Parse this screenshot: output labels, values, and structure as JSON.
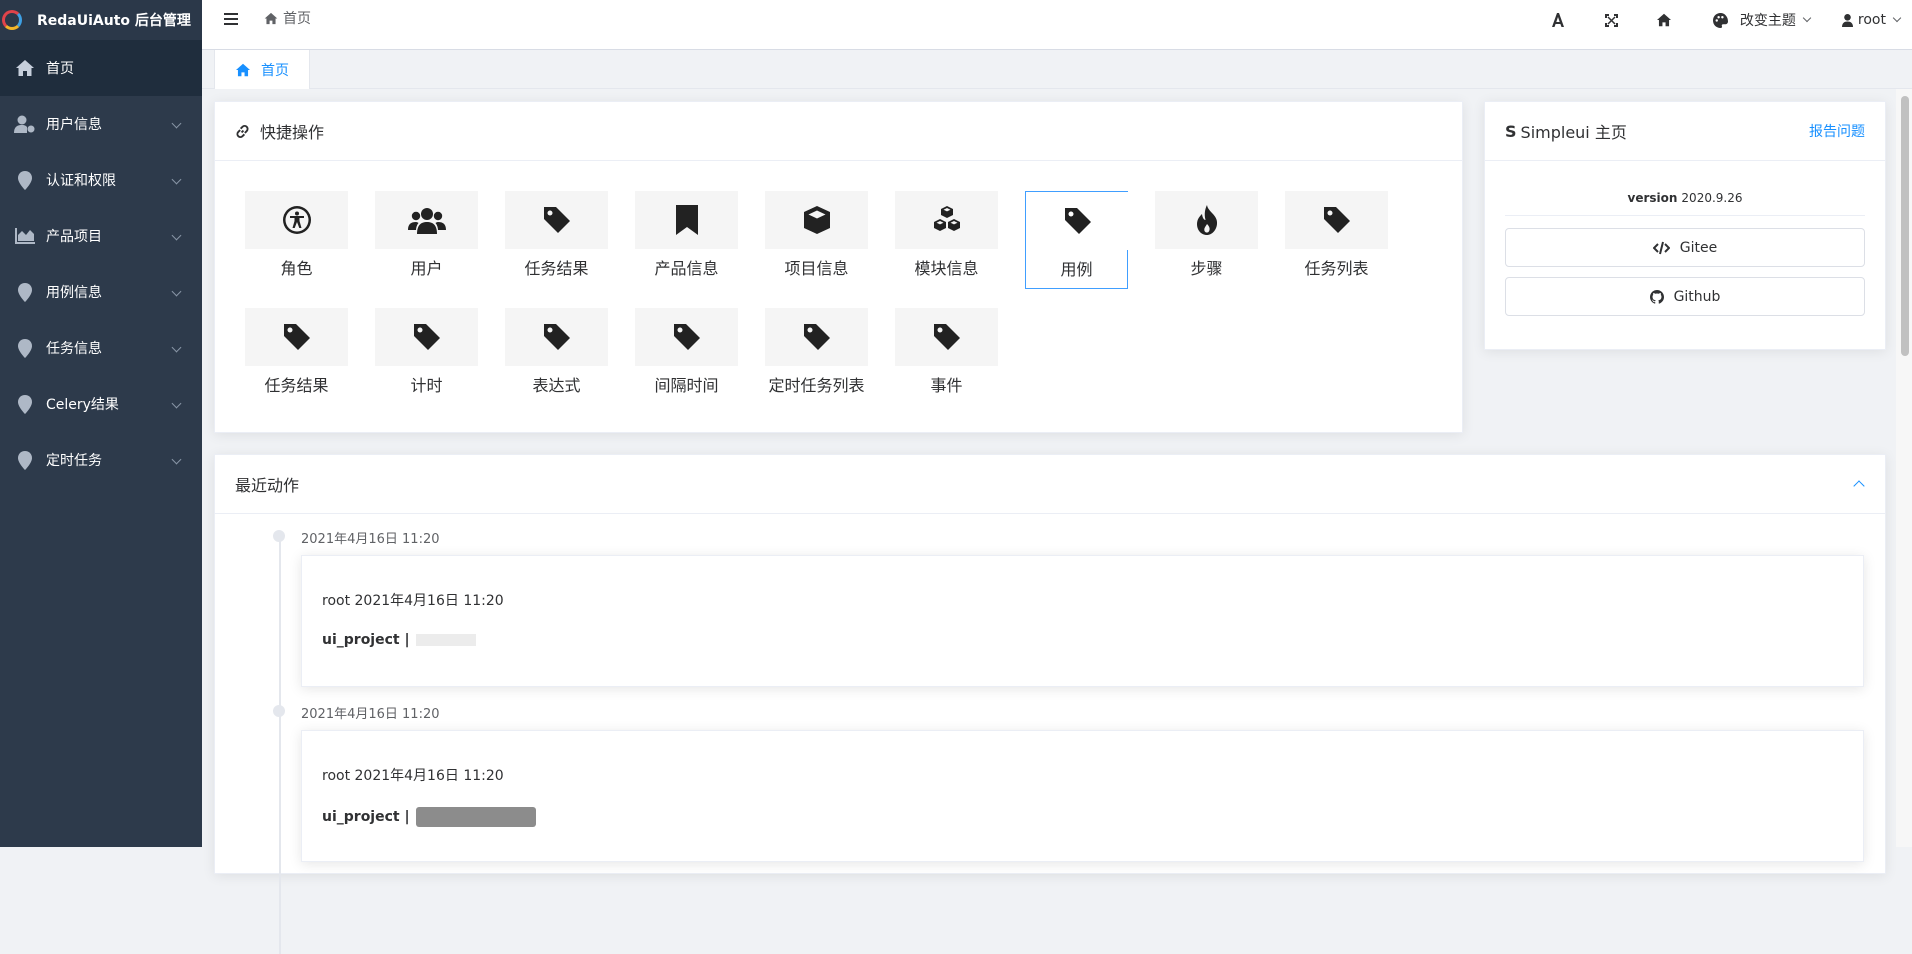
{
  "app": {
    "title": "RedaUiAuto 后台管理"
  },
  "sidebar": {
    "items": [
      {
        "label": "首页",
        "icon": "home-icon",
        "active": true
      },
      {
        "label": "用户信息",
        "icon": "user-cog-icon",
        "active": false
      },
      {
        "label": "认证和权限",
        "icon": "map-marker-icon",
        "active": false
      },
      {
        "label": "产品项目",
        "icon": "chart-area-icon",
        "active": false
      },
      {
        "label": "用例信息",
        "icon": "map-marker-icon",
        "active": false
      },
      {
        "label": "任务信息",
        "icon": "map-marker-icon",
        "active": false
      },
      {
        "label": "Celery结果",
        "icon": "map-marker-icon",
        "active": false
      },
      {
        "label": "定时任务",
        "icon": "map-marker-icon",
        "active": false
      }
    ]
  },
  "header": {
    "breadcrumb": "首页",
    "theme_label": "改变主题",
    "user_label": "root"
  },
  "tabs": [
    {
      "label": "首页"
    }
  ],
  "quick": {
    "title": "快捷操作",
    "items": [
      {
        "label": "角色",
        "icon": "accessibility-icon"
      },
      {
        "label": "用户",
        "icon": "users-icon"
      },
      {
        "label": "任务结果",
        "icon": "tag-icon"
      },
      {
        "label": "产品信息",
        "icon": "bookmark-icon"
      },
      {
        "label": "项目信息",
        "icon": "cube-icon"
      },
      {
        "label": "模块信息",
        "icon": "cubes-icon"
      },
      {
        "label": "用例",
        "icon": "tag-icon",
        "selected": true
      },
      {
        "label": "步骤",
        "icon": "fire-icon"
      },
      {
        "label": "任务列表",
        "icon": "tag-icon"
      },
      {
        "label": "任务结果",
        "icon": "tag-icon"
      },
      {
        "label": "计时",
        "icon": "tag-icon"
      },
      {
        "label": "表达式",
        "icon": "tag-icon"
      },
      {
        "label": "间隔时间",
        "icon": "tag-icon"
      },
      {
        "label": "定时任务列表",
        "icon": "tag-icon"
      },
      {
        "label": "事件",
        "icon": "tag-icon"
      }
    ]
  },
  "simpleui": {
    "title": "Simpleui 主页",
    "report": "报告问题",
    "version_label": "version",
    "version_value": "2020.9.26",
    "gitee": "Gitee",
    "github": "Github"
  },
  "recent": {
    "title": "最近动作",
    "entries": [
      {
        "time": "2021年4月16日 11:20",
        "line1": "root 2021年4月16日 11:20",
        "line2": "ui_project |"
      },
      {
        "time": "2021年4月16日 11:20",
        "line1": "root 2021年4月16日 11:20",
        "line2": "ui_project |"
      }
    ]
  },
  "colors": {
    "sidebar": "#2d3a4b",
    "accent": "#1890ff"
  }
}
